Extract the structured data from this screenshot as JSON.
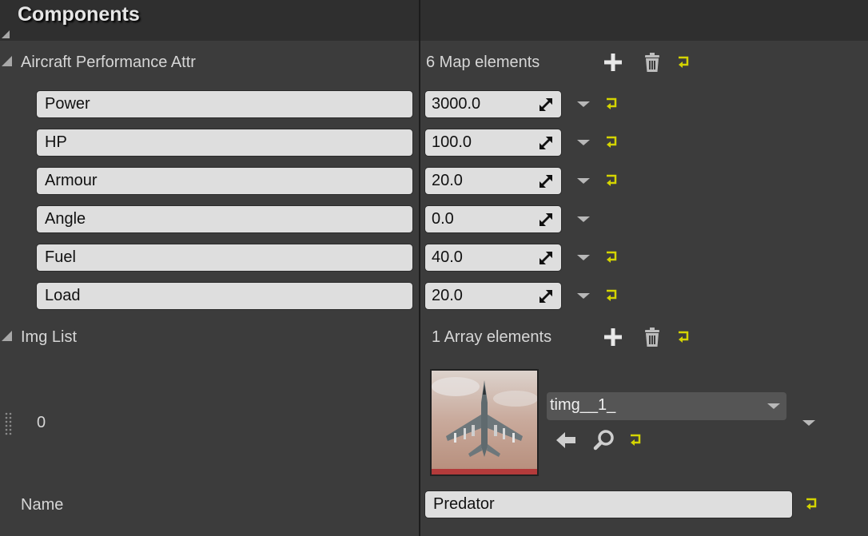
{
  "header": {
    "title": "Components"
  },
  "map_property": {
    "label": "Aircraft Performance Attr",
    "count_text": "6 Map elements",
    "entries": [
      {
        "key": "Power",
        "value": "3000.0",
        "has_reset": true
      },
      {
        "key": "HP",
        "value": "100.0",
        "has_reset": true
      },
      {
        "key": "Armour",
        "value": "20.0",
        "has_reset": true
      },
      {
        "key": "Angle",
        "value": "0.0",
        "has_reset": false
      },
      {
        "key": "Fuel",
        "value": "40.0",
        "has_reset": true
      },
      {
        "key": "Load",
        "value": "20.0",
        "has_reset": true
      }
    ]
  },
  "array_property": {
    "label": "Img List",
    "count_text": "1 Array elements",
    "elements": [
      {
        "index": "0",
        "asset_name": "timg__1_"
      }
    ]
  },
  "name_property": {
    "label": "Name",
    "value": "Predator"
  },
  "colors": {
    "panel_bg": "#3c3c3c",
    "header_bg": "#2f2f2f",
    "field_bg": "#dedede",
    "reset_yellow": "#d4d400",
    "thumbnail_bar": "#b33b3b"
  },
  "icons": [
    "plus-icon",
    "trash-icon",
    "reset-arrow-icon",
    "spin-arrows-icon",
    "chevron-down-icon",
    "back-arrow-icon",
    "search-icon",
    "drag-handle-icon"
  ]
}
